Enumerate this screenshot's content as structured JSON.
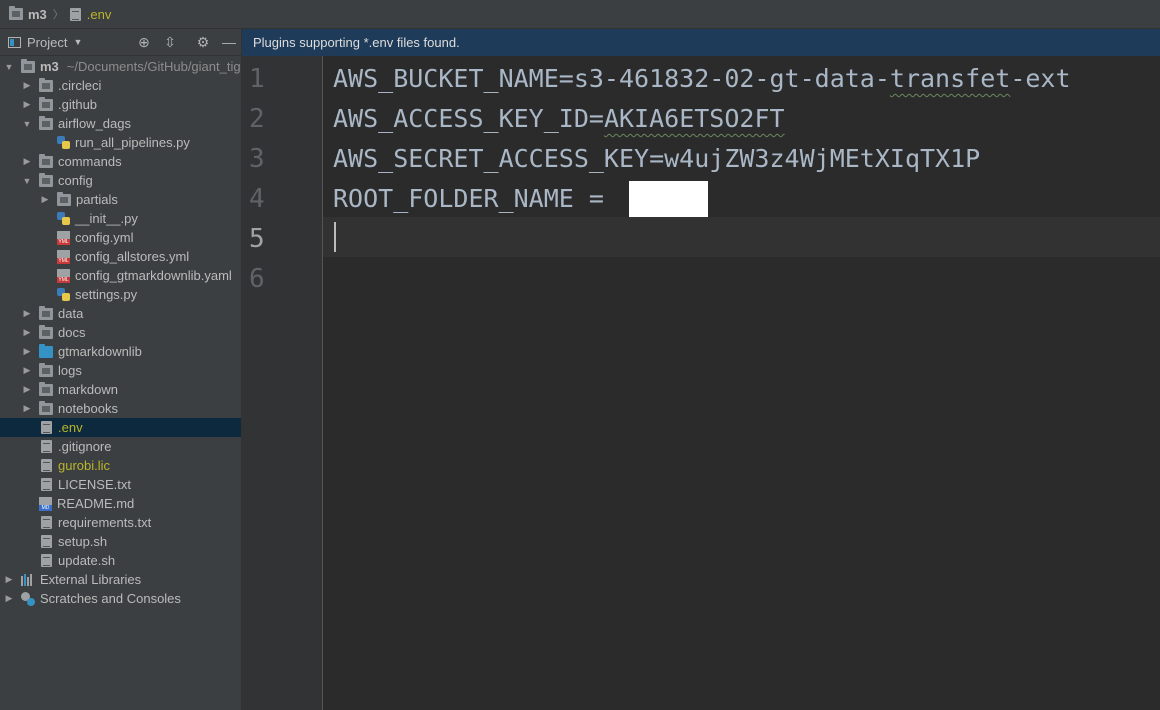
{
  "breadcrumb": {
    "project": "m3",
    "file": ".env"
  },
  "banner": {
    "text": "Plugins supporting *.env files found."
  },
  "project_panel": {
    "title": "Project",
    "toolbar_icons": [
      "locate-icon",
      "collapse-icon",
      "gear-icon",
      "minimize-icon"
    ]
  },
  "tree": {
    "root_name": "m3",
    "root_path": "~/Documents/GitHub/giant_tig",
    "items": {
      "circleci": ".circleci",
      "github": ".github",
      "airflow_dags": "airflow_dags",
      "run_all_pipelines": "run_all_pipelines.py",
      "commands": "commands",
      "config": "config",
      "partials": "partials",
      "init": "__init__.py",
      "config_yml": "config.yml",
      "config_allstores": "config_allstores.yml",
      "config_gtmarkdownlib": "config_gtmarkdownlib.yaml",
      "settings": "settings.py",
      "data": "data",
      "docs": "docs",
      "gtmarkdownlib": "gtmarkdownlib",
      "logs": "logs",
      "markdown": "markdown",
      "notebooks": "notebooks",
      "env": ".env",
      "gitignore": ".gitignore",
      "gurobi": "gurobi.lic",
      "license": "LICENSE.txt",
      "readme": "README.md",
      "requirements": "requirements.txt",
      "setup": "setup.sh",
      "update": "update.sh",
      "external_libraries": "External Libraries",
      "scratches": "Scratches and Consoles"
    }
  },
  "editor": {
    "line_numbers": [
      "1",
      "2",
      "3",
      "4",
      "5",
      "6"
    ],
    "lines": {
      "l1_prefix": "AWS_BUCKET_NAME=s3-461832-02-gt-data-",
      "l1_squig": "transfet",
      "l1_suffix": "-ext",
      "l2_prefix": "AWS_ACCESS_KEY_ID=",
      "l2_squig": "AKIA6ETSO2FT",
      "l3": "AWS_SECRET_ACCESS_KEY=w4ujZW3z4WjMEtXIqTX1P",
      "l4": "ROOT_FOLDER_NAME = ",
      "l5": "",
      "l6": ""
    },
    "current_line": 5
  }
}
